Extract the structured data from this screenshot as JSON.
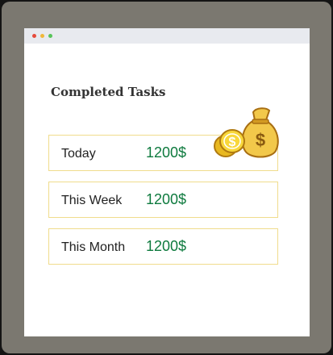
{
  "window": {
    "traffic_lights": [
      "close",
      "minimize",
      "maximize"
    ]
  },
  "heading": "Completed Tasks",
  "rows": [
    {
      "label": "Today",
      "amount": "1200$"
    },
    {
      "label": "This Week",
      "amount": "1200$"
    },
    {
      "label": "This Month",
      "amount": "1200$"
    }
  ],
  "colors": {
    "amount": "#0e7a3e",
    "row_border": "#f0dc8c",
    "frame": "#7b7870"
  },
  "icon": "money-bag-with-coins-icon"
}
